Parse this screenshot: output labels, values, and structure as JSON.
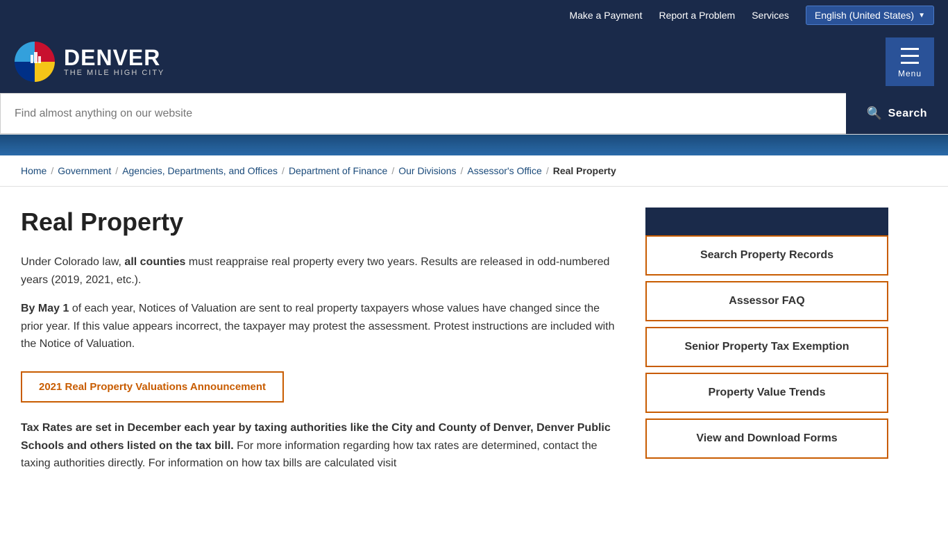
{
  "utility": {
    "links": [
      "Make a Payment",
      "Report a Problem",
      "Services"
    ],
    "language_button": "English (United States)"
  },
  "header": {
    "city_name": "DENVER",
    "tagline": "THE MILE HIGH CITY",
    "menu_label": "Menu"
  },
  "search": {
    "placeholder": "Find almost anything on our website",
    "button_label": "Search"
  },
  "breadcrumb": {
    "items": [
      "Home",
      "Government",
      "Agencies, Departments, and Offices",
      "Department of Finance",
      "Our Divisions",
      "Assessor's Office"
    ],
    "current": "Real Property"
  },
  "main": {
    "title": "Real Property",
    "paragraph1_prefix": "Under Colorado law, ",
    "paragraph1_bold": "all counties",
    "paragraph1_suffix": " must reappraise real property every two years. Results are released in odd-numbered years (2019, 2021, etc.).",
    "paragraph2_prefix": "By May 1",
    "paragraph2_suffix": " of each year, Notices of Valuation are sent to real property taxpayers whose values have changed since the prior year. If this value appears incorrect, the taxpayer may protest the assessment. Protest instructions are included with the Notice of Valuation.",
    "announcement_btn": "2021 Real Property Valuations Announcement",
    "paragraph3_bold": "Tax Rates are set in December each year by taxing authorities like the City and County of Denver, Denver Public Schools and others listed on the tax bill.",
    "paragraph3_suffix": " For more information regarding how tax rates are determined, contact the taxing authorities directly. For information on how tax bills are calculated visit"
  },
  "sidebar": {
    "buttons": [
      "Search Property Records",
      "Assessor FAQ",
      "Senior Property Tax Exemption",
      "Property Value Trends",
      "View and Download Forms"
    ]
  }
}
